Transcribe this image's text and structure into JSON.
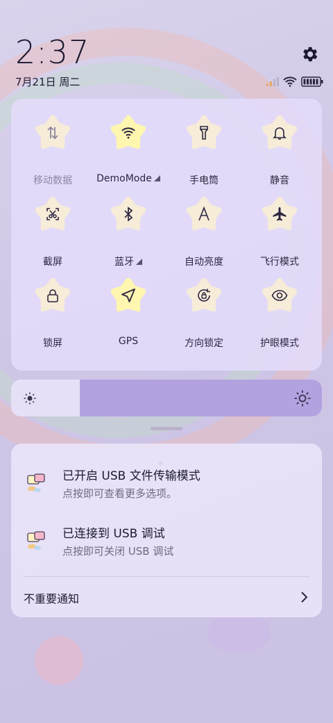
{
  "status": {
    "time": "2:37",
    "date": "7月21日 周二"
  },
  "header_icons": {
    "settings": "gear-icon",
    "signal": "cell-signal-icon",
    "wifi": "wifi-icon",
    "battery": "battery-icon"
  },
  "quick_settings": {
    "tiles": [
      {
        "label": "移动数据",
        "icon": "mobile-data-icon",
        "active": false
      },
      {
        "label": "DemoMode",
        "icon": "wifi-icon",
        "active": true,
        "has_menu": true
      },
      {
        "label": "手电筒",
        "icon": "flashlight-icon",
        "active": false
      },
      {
        "label": "静音",
        "icon": "bell-icon",
        "active": false
      },
      {
        "label": "截屏",
        "icon": "screenshot-icon",
        "active": false
      },
      {
        "label": "蓝牙",
        "icon": "bluetooth-icon",
        "active": false,
        "has_menu": true
      },
      {
        "label": "自动亮度",
        "icon": "auto-brightness-icon",
        "active": false
      },
      {
        "label": "飞行模式",
        "icon": "airplane-icon",
        "active": false
      },
      {
        "label": "锁屏",
        "icon": "lock-icon",
        "active": false
      },
      {
        "label": "GPS",
        "icon": "location-arrow-icon",
        "active": true
      },
      {
        "label": "方向锁定",
        "icon": "rotation-lock-icon",
        "active": false
      },
      {
        "label": "护眼模式",
        "icon": "eye-icon",
        "active": false
      }
    ],
    "page_current": 1,
    "page_count": 2
  },
  "brightness": {
    "level": 0.78
  },
  "notifications": [
    {
      "title": "已开启 USB 文件传输模式",
      "subtitle": "点按即可查看更多选项。",
      "icon": "usb-chat-icon"
    },
    {
      "title": "已连接到 USB 调试",
      "subtitle": "点按即可关闭 USB 调试",
      "icon": "usb-chat-icon"
    }
  ],
  "minor_notifications": {
    "label": "不重要通知"
  },
  "colors": {
    "accent": "#b2a2e0",
    "active_star": "#fff6b0",
    "inactive_star": "#f6ecd8"
  }
}
